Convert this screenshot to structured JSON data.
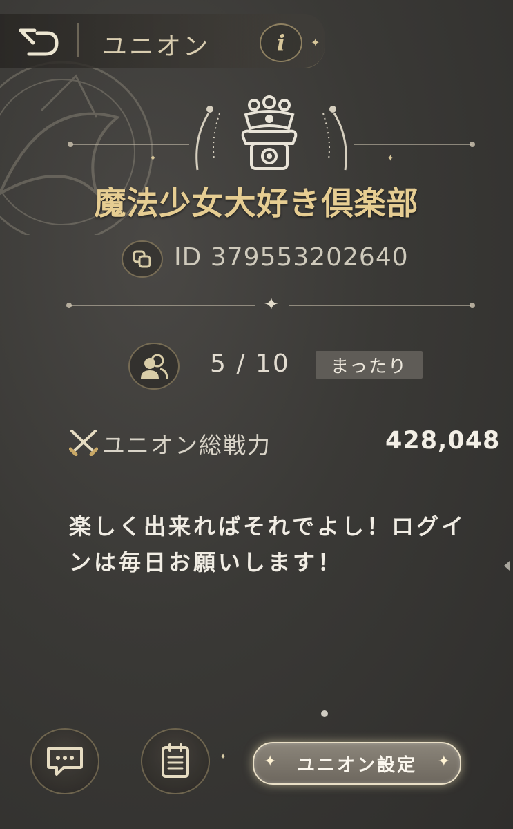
{
  "header": {
    "title": "ユニオン",
    "back_icon": "back-arrow-icon",
    "info_label": "i"
  },
  "union": {
    "name": "魔法少女大好き倶楽部",
    "id": "ID 379553202640",
    "members": "5 / 10",
    "style": "まったり",
    "power_label": "ユニオン総戦力",
    "power_value": "428,048",
    "description": "楽しく出来ればそれでよし！ログインは毎日お願いします！"
  },
  "footer": {
    "settings_label": "ユニオン設定",
    "chat_icon": "chat-icon",
    "board_icon": "notice-board-icon"
  },
  "colors": {
    "gold": "#e6cd92",
    "background": "#3a3936",
    "badge": "#5f5c57"
  }
}
